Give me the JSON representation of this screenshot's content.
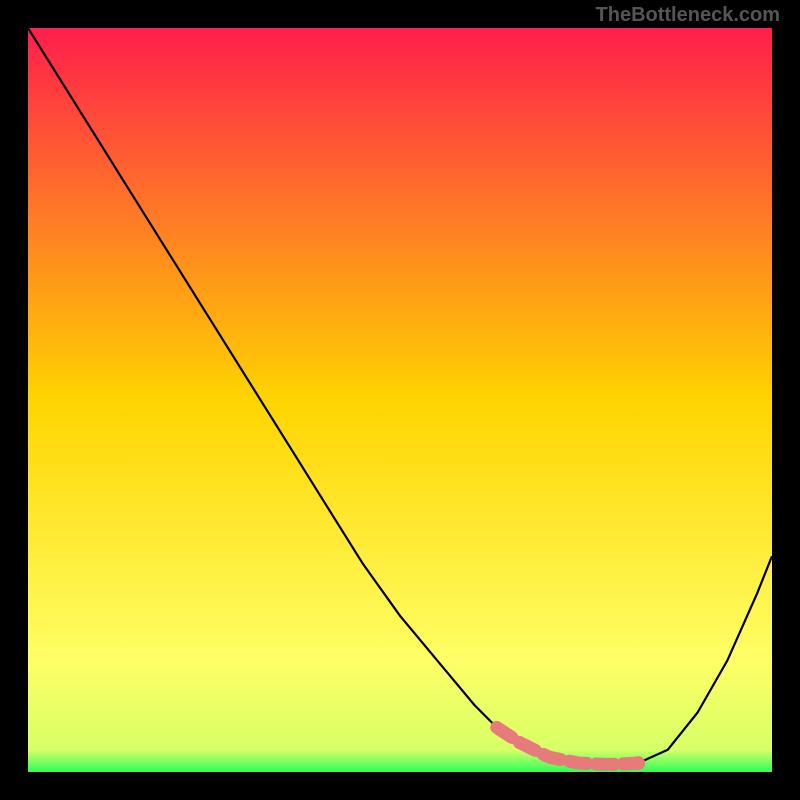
{
  "watermark": "TheBottleneck.com",
  "chart_data": {
    "type": "line",
    "title": "",
    "xlabel": "",
    "ylabel": "",
    "xlim": [
      0,
      100
    ],
    "ylim": [
      0,
      100
    ],
    "gradient_stops": [
      {
        "offset": 0,
        "color": "#ff1e4c"
      },
      {
        "offset": 50,
        "color": "#ffd400"
      },
      {
        "offset": 85,
        "color": "#ffff66"
      },
      {
        "offset": 97,
        "color": "#d8ff66"
      },
      {
        "offset": 100,
        "color": "#2eff5a"
      }
    ],
    "series": [
      {
        "name": "bottleneck-curve",
        "x": [
          0,
          5,
          10,
          15,
          20,
          25,
          30,
          35,
          40,
          45,
          50,
          55,
          60,
          63,
          66,
          70,
          74,
          78,
          82,
          86,
          90,
          94,
          98,
          100
        ],
        "values": [
          100,
          92,
          84,
          76,
          68,
          60,
          52,
          44,
          36,
          28,
          21,
          15,
          9,
          6,
          4,
          2,
          1.2,
          1.0,
          1.2,
          3,
          8,
          15,
          24,
          29
        ]
      }
    ],
    "good_region_band": {
      "x_start": 63,
      "x_end": 82,
      "color": "#e77a7a"
    },
    "end_dot": {
      "x": 82,
      "color": "#e77a7a"
    }
  }
}
